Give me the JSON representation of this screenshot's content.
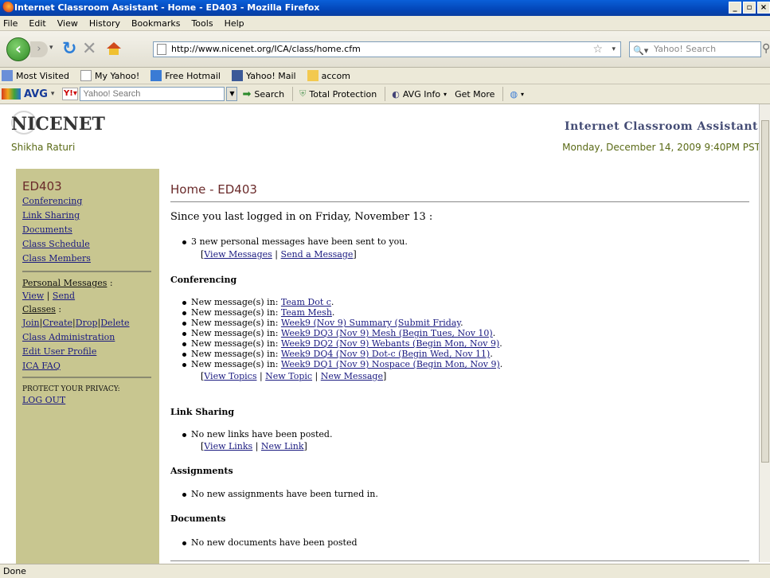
{
  "window": {
    "title": "Internet Classroom Assistant - Home - ED403 - Mozilla Firefox"
  },
  "menu": [
    "File",
    "Edit",
    "View",
    "History",
    "Bookmarks",
    "Tools",
    "Help"
  ],
  "nav": {
    "url": "http://www.nicenet.org/ICA/class/home.cfm",
    "search_placeholder": "Yahoo! Search"
  },
  "bookmarks": [
    "Most Visited",
    "My Yahoo!",
    "Free Hotmail",
    "Yahoo! Mail",
    "accom"
  ],
  "avg_toolbar": {
    "brand": "AVG",
    "search_placeholder": "Yahoo! Search",
    "search": "Search",
    "total_protection": "Total Protection",
    "avg_info": "AVG Info",
    "get_more": "Get More"
  },
  "site": {
    "logo": "NICENET",
    "user": "Shikha Raturi",
    "app_title": "Internet Classroom Assistant",
    "datetime": "Monday, December 14, 2009 9:40PM PST"
  },
  "sidebar": {
    "class": "ED403",
    "links": [
      "Conferencing",
      "Link Sharing",
      "Documents",
      "Class Schedule",
      "Class Members"
    ],
    "personal_messages": "Personal Messages",
    "view": "View",
    "send": "Send",
    "classes": "Classes",
    "join": "Join",
    "create": "Create",
    "drop": "Drop",
    "delete": "Delete",
    "class_admin": "Class Administration",
    "edit_profile": "Edit User Profile",
    "faq": "ICA FAQ",
    "privacy": "PROTECT YOUR PRIVACY:",
    "logout": "LOG OUT"
  },
  "main": {
    "title": "Home - ED403",
    "since": "Since you last logged in on Friday, November 13 :",
    "messages": {
      "text": "3 new personal messages have been sent to you.",
      "view": "View Messages",
      "send": "Send a Message"
    },
    "conferencing": {
      "heading": "Conferencing",
      "prefix": "New message(s) in: ",
      "items": [
        "Team Dot c",
        "Team Mesh",
        "Week9 (Nov 9) Summary (Submit Friday",
        "Week9 DQ3 (Nov 9) Mesh (Begin Tues, Nov 10)",
        "Week9 DQ2 (Nov 9) Webants (Begin Mon, Nov 9)",
        "Week9 DQ4 (Nov 9) Dot-c (Begin Wed, Nov 11)",
        "Week9 DQ1 (Nov 9) Nospace (Begin Mon, Nov 9)"
      ],
      "view_topics": "View Topics",
      "new_topic": "New Topic",
      "new_message": "New Message"
    },
    "link_sharing": {
      "heading": "Link Sharing",
      "text": "No new links have been posted.",
      "view_links": "View Links",
      "new_link": "New Link"
    },
    "assignments": {
      "heading": "Assignments",
      "text": "No new assignments have been turned in."
    },
    "documents": {
      "heading": "Documents",
      "text": "No new documents have been posted"
    }
  },
  "status": "Done"
}
